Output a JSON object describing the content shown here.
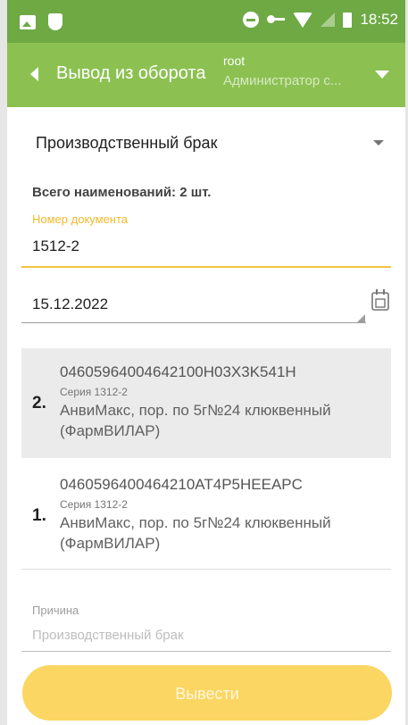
{
  "status_bar": {
    "time": "18:52",
    "icons": [
      "gallery-icon",
      "shield-icon",
      "do-not-disturb-icon",
      "vpn-key-icon",
      "wifi-off-icon",
      "signal-icon",
      "battery-icon"
    ]
  },
  "header": {
    "title": "Вывод из оборота",
    "user": "root",
    "role": "Администратор с...",
    "background": "#8cc152",
    "status_background": "#6ea944"
  },
  "form": {
    "reason_select": "Производственный брак",
    "total": "Всего наименований: 2 шт.",
    "document_number_label": "Номер документа",
    "document_number": "1512-2",
    "date": "15.12.2022",
    "accent": "#f3c63f"
  },
  "items": [
    {
      "num": "2.",
      "code": "04605964004642100H03X3K541H",
      "series": "Серия 1312-2",
      "name": "АнвиМакс, пор. по 5г№24 клюквенный (ФармВИЛАР)"
    },
    {
      "num": "1.",
      "code": "0460596400464210AT4P5HEEAPC",
      "series": "Серия 1312-2",
      "name": "АнвиМакс, пор. по 5г№24 клюквенный (ФармВИЛАР)"
    }
  ],
  "reason": {
    "label": "Причина",
    "placeholder": "Производственный брак"
  },
  "submit": {
    "label": "Вывести",
    "color": "#fbd663"
  }
}
